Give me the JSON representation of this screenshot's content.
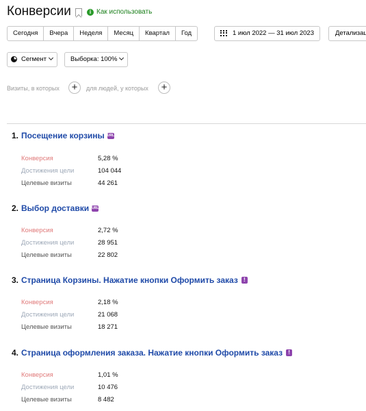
{
  "header": {
    "title": "Конверсии",
    "how_to_use": "Как использовать"
  },
  "toolbar": {
    "periods": [
      "Сегодня",
      "Вчера",
      "Неделя",
      "Месяц",
      "Квартал",
      "Год"
    ],
    "date_range": "1 июл 2022 — 31 июл 2023",
    "detail_label": "Детализац"
  },
  "filters": {
    "segment_label": "Сегмент",
    "sample_label": "Выборка: 100%",
    "visits_label": "Визиты, в которых",
    "people_label": "для людей, у которых"
  },
  "metric_labels": {
    "conversion": "Конверсия",
    "achievements": "Достижения цели",
    "target_visits": "Целевые визиты"
  },
  "goals": [
    {
      "num": "1.",
      "name": "Посещение корзины",
      "badge": "url",
      "badge_text": "URL",
      "conversion": "5,28 %",
      "achievements": "104 044",
      "target_visits": "44 261"
    },
    {
      "num": "2.",
      "name": "Выбор доставки",
      "badge": "url",
      "badge_text": "URL",
      "conversion": "2,72 %",
      "achievements": "28 951",
      "target_visits": "22 802"
    },
    {
      "num": "3.",
      "name": "Страница Корзины. Нажатие кнопки Оформить заказ",
      "badge": "event",
      "badge_text": "!",
      "conversion": "2,18 %",
      "achievements": "21 068",
      "target_visits": "18 271"
    },
    {
      "num": "4.",
      "name": "Страница оформления заказа. Нажатие кнопки Оформить заказ",
      "badge": "event",
      "badge_text": "!",
      "conversion": "1,01 %",
      "achievements": "10 476",
      "target_visits": "8 482"
    }
  ],
  "colors": {
    "goal_link": "#1f4aa8",
    "conversion_label": "#e07a7a",
    "achievements_label": "#9ea9b8",
    "badge": "#8e44ad",
    "how_to_use": "#1a7f1a"
  }
}
